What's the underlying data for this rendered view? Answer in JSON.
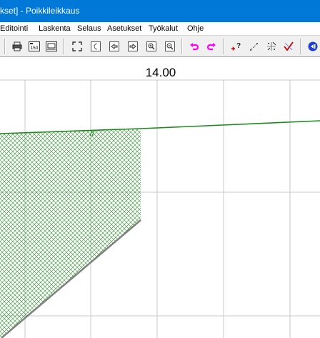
{
  "window": {
    "title": "kset] - Poikkileikkaus"
  },
  "menu": {
    "items": [
      {
        "label": "Editointi"
      },
      {
        "label": "Laskenta"
      },
      {
        "label": "Selaus"
      },
      {
        "label": "Asetukset"
      },
      {
        "label": "Työkalut"
      },
      {
        "label": "Ohje"
      }
    ]
  },
  "toolbar": {
    "buttons": [
      {
        "icon": "printer-icon"
      },
      {
        "icon": "scale-150-icon",
        "text": "150"
      },
      {
        "icon": "page-layout-icon"
      },
      {
        "icon": "zoom-extents-icon"
      },
      {
        "icon": "night-mode-icon"
      },
      {
        "icon": "previous-section-icon"
      },
      {
        "icon": "next-section-icon"
      },
      {
        "icon": "zoom-in-icon"
      },
      {
        "icon": "zoom-out-icon"
      },
      {
        "icon": "undo-icon"
      },
      {
        "icon": "redo-icon"
      },
      {
        "icon": "add-point-icon"
      },
      {
        "icon": "measure-distance-icon"
      },
      {
        "icon": "coordinates-xyz-icon"
      },
      {
        "icon": "check-mark-icon"
      },
      {
        "icon": "rewind-icon"
      }
    ],
    "colors": {
      "undo": "#ff00ff",
      "redo": "#ff00ff",
      "add_point": "#cc0000",
      "rewind": "#1e3fd6"
    }
  },
  "canvas": {
    "section_label": "14.00",
    "colors": {
      "grid": "#c8c8c8",
      "terrain_line": "#1e8a1e",
      "hatch": "#1e8a1e",
      "slope_line": "#808080"
    }
  }
}
